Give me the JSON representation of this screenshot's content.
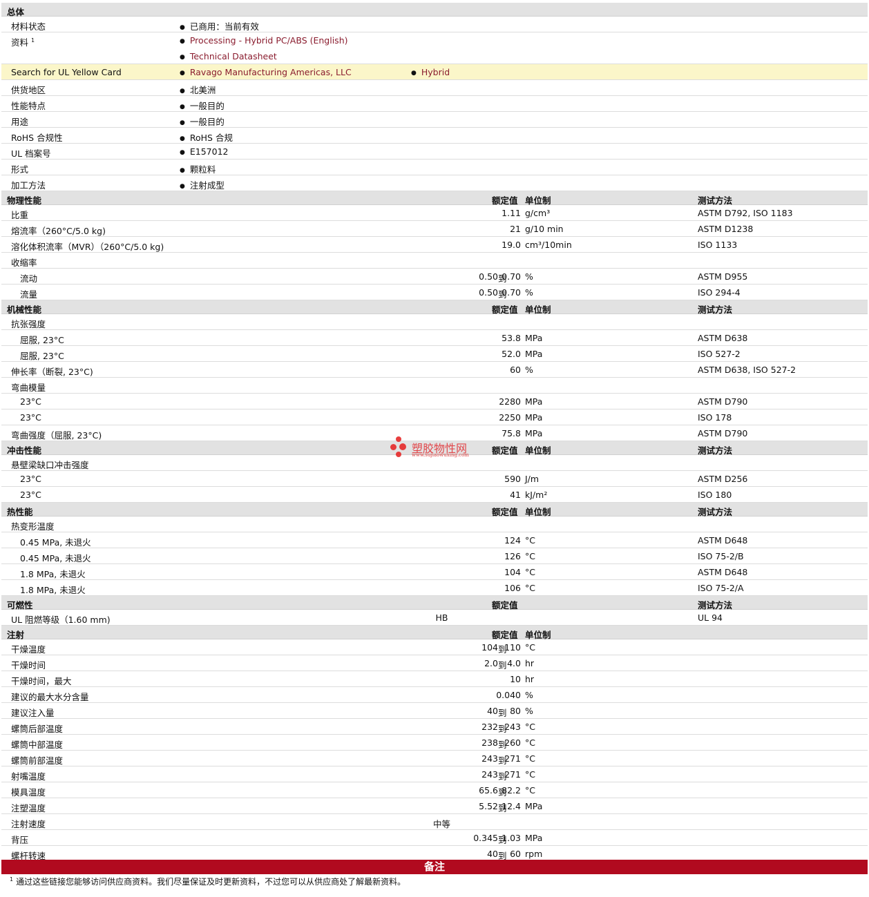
{
  "general": {
    "section_title": "总体",
    "status_label": "材料状态",
    "status_value": "已商用：当前有效",
    "docs_label": "资料",
    "docs_sup": "1",
    "docs_links": [
      "Processing - Hybrid PC/ABS (English)",
      "Technical Datasheet"
    ],
    "ul_search_label": "Search for UL Yellow Card",
    "ul_search_links": [
      "Ravago Manufacturing Americas, LLC",
      "Hybrid"
    ],
    "rows": [
      {
        "label": "供货地区",
        "value": "北美洲"
      },
      {
        "label": "性能特点",
        "value": "一般目的"
      },
      {
        "label": "用途",
        "value": "一般目的"
      },
      {
        "label": "RoHS 合规性",
        "value": "RoHS 合规"
      },
      {
        "label": "UL 档案号",
        "value": "E157012"
      },
      {
        "label": "形式",
        "value": "颗粒料"
      },
      {
        "label": "加工方法",
        "value": "注射成型"
      }
    ]
  },
  "columns": {
    "nominal": "额定值",
    "unit": "单位制",
    "method": "测试方法"
  },
  "to_word": "到",
  "physical": {
    "title": "物理性能",
    "rows": [
      {
        "label": "比重",
        "v1": "1.11",
        "unit": "g/cm³",
        "method": "ASTM D792, ISO 1183"
      },
      {
        "label": "熔流率（260°C/5.0 kg)",
        "v1": "21",
        "unit": "g/10 min",
        "method": "ASTM D1238"
      },
      {
        "label": "溶化体积流率（MVR）（260°C/5.0 kg)",
        "v1": "19.0",
        "unit": "cm³/10min",
        "method": "ISO 1133"
      },
      {
        "label": "收缩率"
      },
      {
        "label": "流动",
        "sub": true,
        "v0": "0.50",
        "v1": "0.70",
        "unit": "%",
        "method": "ASTM D955"
      },
      {
        "label": "流量",
        "sub": true,
        "v0": "0.50",
        "v1": "0.70",
        "unit": "%",
        "method": "ISO 294-4"
      }
    ]
  },
  "mechanical": {
    "title": "机械性能",
    "rows": [
      {
        "label": "抗张强度"
      },
      {
        "label": "屈服, 23°C",
        "sub": true,
        "v1": "53.8",
        "unit": "MPa",
        "method": "ASTM D638"
      },
      {
        "label": "屈服, 23°C",
        "sub": true,
        "v1": "52.0",
        "unit": "MPa",
        "method": "ISO 527-2"
      },
      {
        "label": "伸长率（断裂, 23°C)",
        "v1": "60",
        "unit": "%",
        "method": "ASTM D638, ISO 527-2"
      },
      {
        "label": "弯曲模量"
      },
      {
        "label": "23°C",
        "sub": true,
        "v1": "2280",
        "unit": "MPa",
        "method": "ASTM D790"
      },
      {
        "label": "23°C",
        "sub": true,
        "v1": "2250",
        "unit": "MPa",
        "method": "ISO 178"
      },
      {
        "label": "弯曲强度（屈服, 23°C)",
        "v1": "75.8",
        "unit": "MPa",
        "method": "ASTM D790"
      }
    ]
  },
  "impact": {
    "title": "冲击性能",
    "rows": [
      {
        "label": "悬壁梁缺口冲击强度"
      },
      {
        "label": "23°C",
        "sub": true,
        "v1": "590",
        "unit": "J/m",
        "method": "ASTM D256"
      },
      {
        "label": "23°C",
        "sub": true,
        "v1": "41",
        "unit": "kJ/m²",
        "method": "ISO 180"
      }
    ]
  },
  "thermal": {
    "title": "热性能",
    "rows": [
      {
        "label": "热变形温度"
      },
      {
        "label": "0.45 MPa, 未退火",
        "sub": true,
        "v1": "124",
        "unit": "°C",
        "method": "ASTM D648"
      },
      {
        "label": "0.45 MPa, 未退火",
        "sub": true,
        "v1": "126",
        "unit": "°C",
        "method": "ISO 75-2/B"
      },
      {
        "label": "1.8 MPa, 未退火",
        "sub": true,
        "v1": "104",
        "unit": "°C",
        "method": "ASTM D648"
      },
      {
        "label": "1.8 MPa, 未退火",
        "sub": true,
        "v1": "106",
        "unit": "°C",
        "method": "ISO 75-2/A"
      }
    ]
  },
  "flammability": {
    "title": "可燃性",
    "rows": [
      {
        "label": "UL 阻燃等级（1.60 mm)",
        "center": "HB",
        "method": "UL 94"
      }
    ]
  },
  "injection": {
    "title": "注射",
    "rows": [
      {
        "label": "干燥温度",
        "v0": "104",
        "v1": "110",
        "unit": "°C"
      },
      {
        "label": "干燥时间",
        "v0": "2.0",
        "v1": "4.0",
        "unit": "hr"
      },
      {
        "label": "干燥时间，最大",
        "v1": "10",
        "unit": "hr"
      },
      {
        "label": "建议的最大水分含量",
        "v1": "0.040",
        "unit": "%"
      },
      {
        "label": "建议注入量",
        "v0": "40",
        "v1": "80",
        "unit": "%"
      },
      {
        "label": "螺筒后部温度",
        "v0": "232",
        "v1": "243",
        "unit": "°C"
      },
      {
        "label": "螺筒中部温度",
        "v0": "238",
        "v1": "260",
        "unit": "°C"
      },
      {
        "label": "螺筒前部温度",
        "v0": "243",
        "v1": "271",
        "unit": "°C"
      },
      {
        "label": "射嘴温度",
        "v0": "243",
        "v1": "271",
        "unit": "°C"
      },
      {
        "label": "模具温度",
        "v0": "65.6",
        "v1": "82.2",
        "unit": "°C"
      },
      {
        "label": "注塑温度",
        "v0": "5.52",
        "v1": "12.4",
        "unit": "MPa"
      },
      {
        "label": "注射速度",
        "center": "中等"
      },
      {
        "label": "背压",
        "v0": "0.345",
        "v1": "1.03",
        "unit": "MPa"
      },
      {
        "label": "螺杆转速",
        "v0": "40",
        "v1": "60",
        "unit": "rpm"
      }
    ]
  },
  "notes": {
    "title": "备注",
    "sup": "1",
    "text": "通过这些链接您能够访问供应商资料。我们尽量保证及时更新资料，不过您可以从供应商处了解最新资料。"
  },
  "watermark": {
    "name": "塑胶物性网",
    "url": "www.sujiaowuxing.com"
  },
  "colors": {
    "link": "#8a1c2e",
    "notes_bar": "#b10a1f",
    "highlight": "#fbf6c9",
    "header": "#e2e2e2"
  }
}
